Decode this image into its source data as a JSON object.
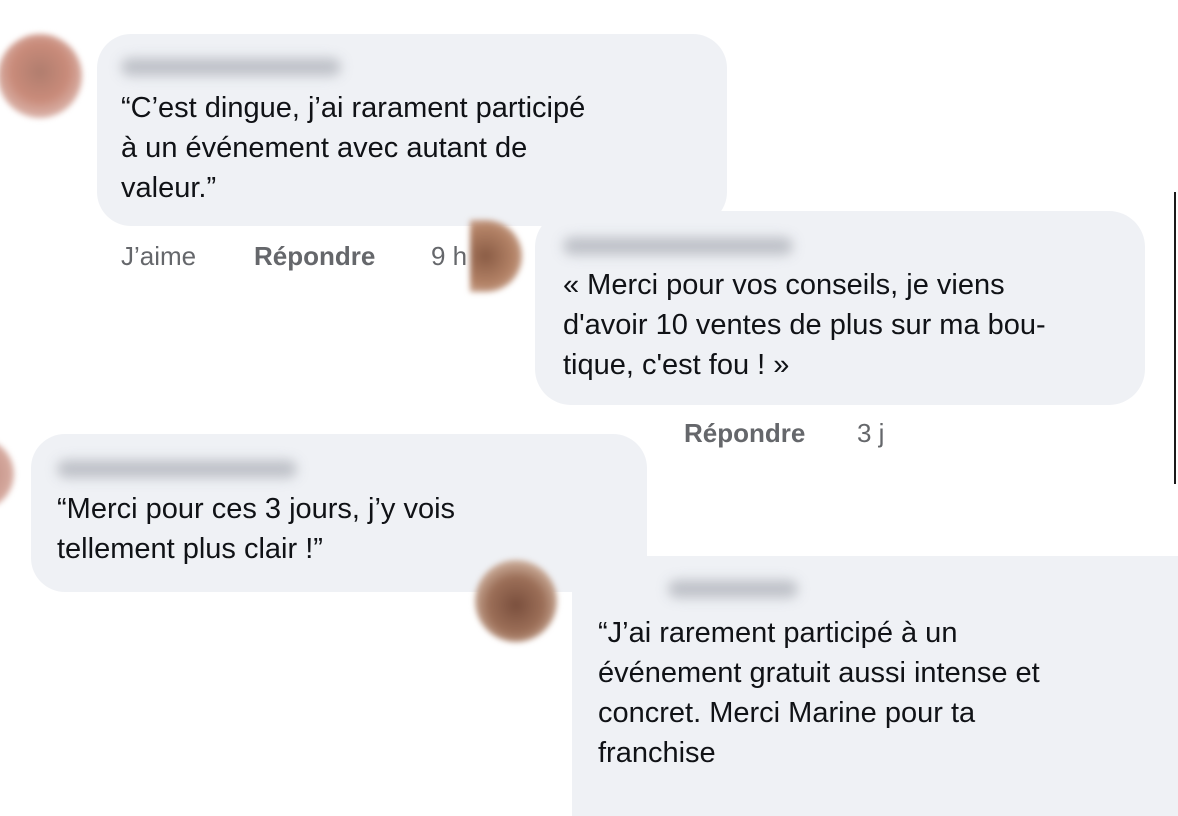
{
  "comments": [
    {
      "text": "“C’est dingue, j’ai rarament participé\nà un événement avec autant de\nvaleur.”",
      "actions": {
        "like": "J’aime",
        "reply": "Répondre",
        "time": "9 h"
      }
    },
    {
      "text": "« Merci pour vos conseils, je viens\nd'avoir 10 ventes de plus sur ma bou-\ntique, c'est fou ! »",
      "actions": {
        "reply": "Répondre",
        "time": "3 j"
      }
    },
    {
      "text": "“Merci pour ces 3 jours, j’y vois\ntellement plus clair !”"
    },
    {
      "text": "“J’ai rarement participé à un\névénement gratuit aussi intense et\nconcret. Merci Marine pour ta\nfranchise"
    }
  ]
}
